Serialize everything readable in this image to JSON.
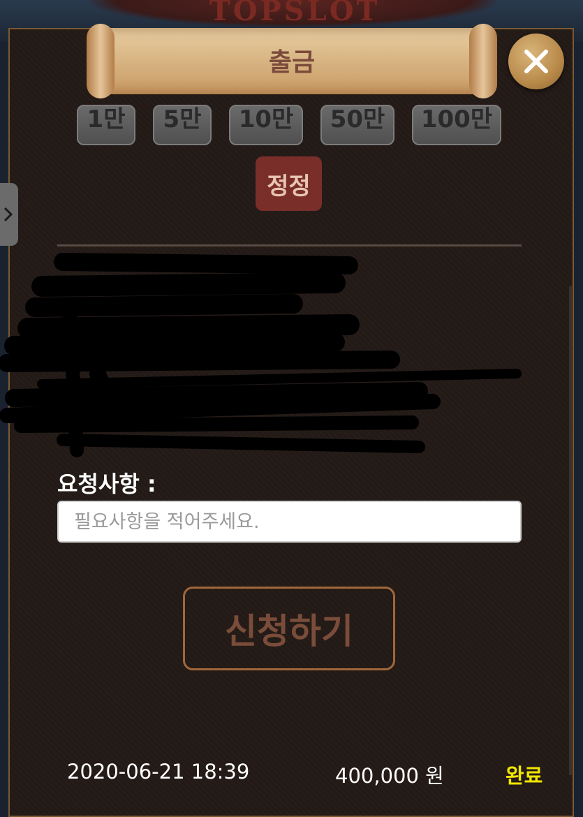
{
  "header": {
    "logo_text": "TOPSLOT",
    "title": "출금",
    "close_icon": "close-icon"
  },
  "amount_buttons": [
    {
      "label": "1만"
    },
    {
      "label": "5만"
    },
    {
      "label": "10만"
    },
    {
      "label": "50만"
    },
    {
      "label": "100만"
    }
  ],
  "reset_label": "정정",
  "request": {
    "label": "요청사항 :",
    "placeholder": "필요사항을 적어주세요."
  },
  "submit_label": "신청하기",
  "history": [
    {
      "date": "2020-06-21 18:39",
      "amount": "400,000 원",
      "status": "완료",
      "status_color": "#f2e600"
    }
  ],
  "colors": {
    "panel_bg": "#231a16",
    "reset_bg": "#7a2e2a",
    "border_gold": "#a0673a"
  }
}
